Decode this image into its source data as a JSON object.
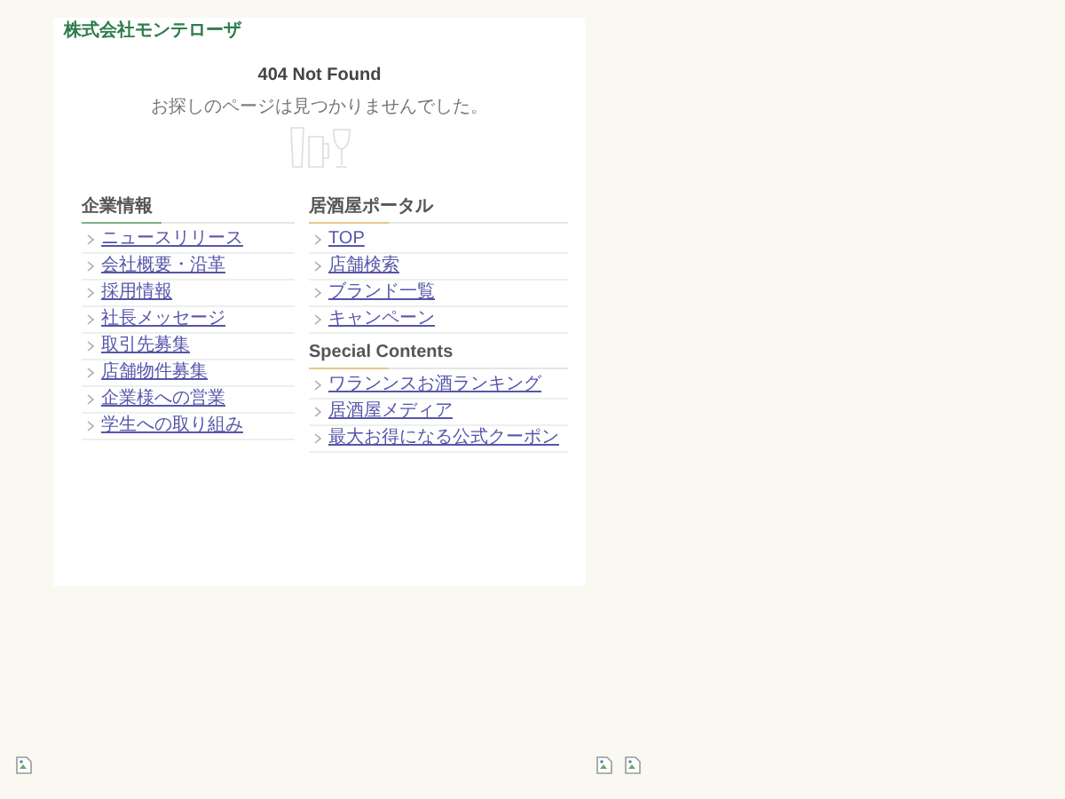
{
  "site_name": "株式会社モンテローザ",
  "title": "404 Not Found",
  "message": "お探しのページは見つかりませんでした。",
  "columns": [
    {
      "sections": [
        {
          "heading": "企業情報",
          "links": [
            "ニュースリリース",
            "会社概要・沿革",
            "採用情報",
            "社長メッセージ",
            "取引先募集",
            "店舗物件募集",
            "企業様への営業",
            "学生への取り組み"
          ]
        }
      ]
    },
    {
      "sections": [
        {
          "heading": "居酒屋ポータル",
          "links": [
            "TOP",
            "店舗検索",
            "ブランド一覧",
            "キャンペーン"
          ]
        },
        {
          "heading": "Special Contents",
          "links": [
            "ワランンスお酒ランキング",
            "居酒屋メディア",
            "最大お得になる公式クーポン"
          ]
        }
      ]
    }
  ]
}
